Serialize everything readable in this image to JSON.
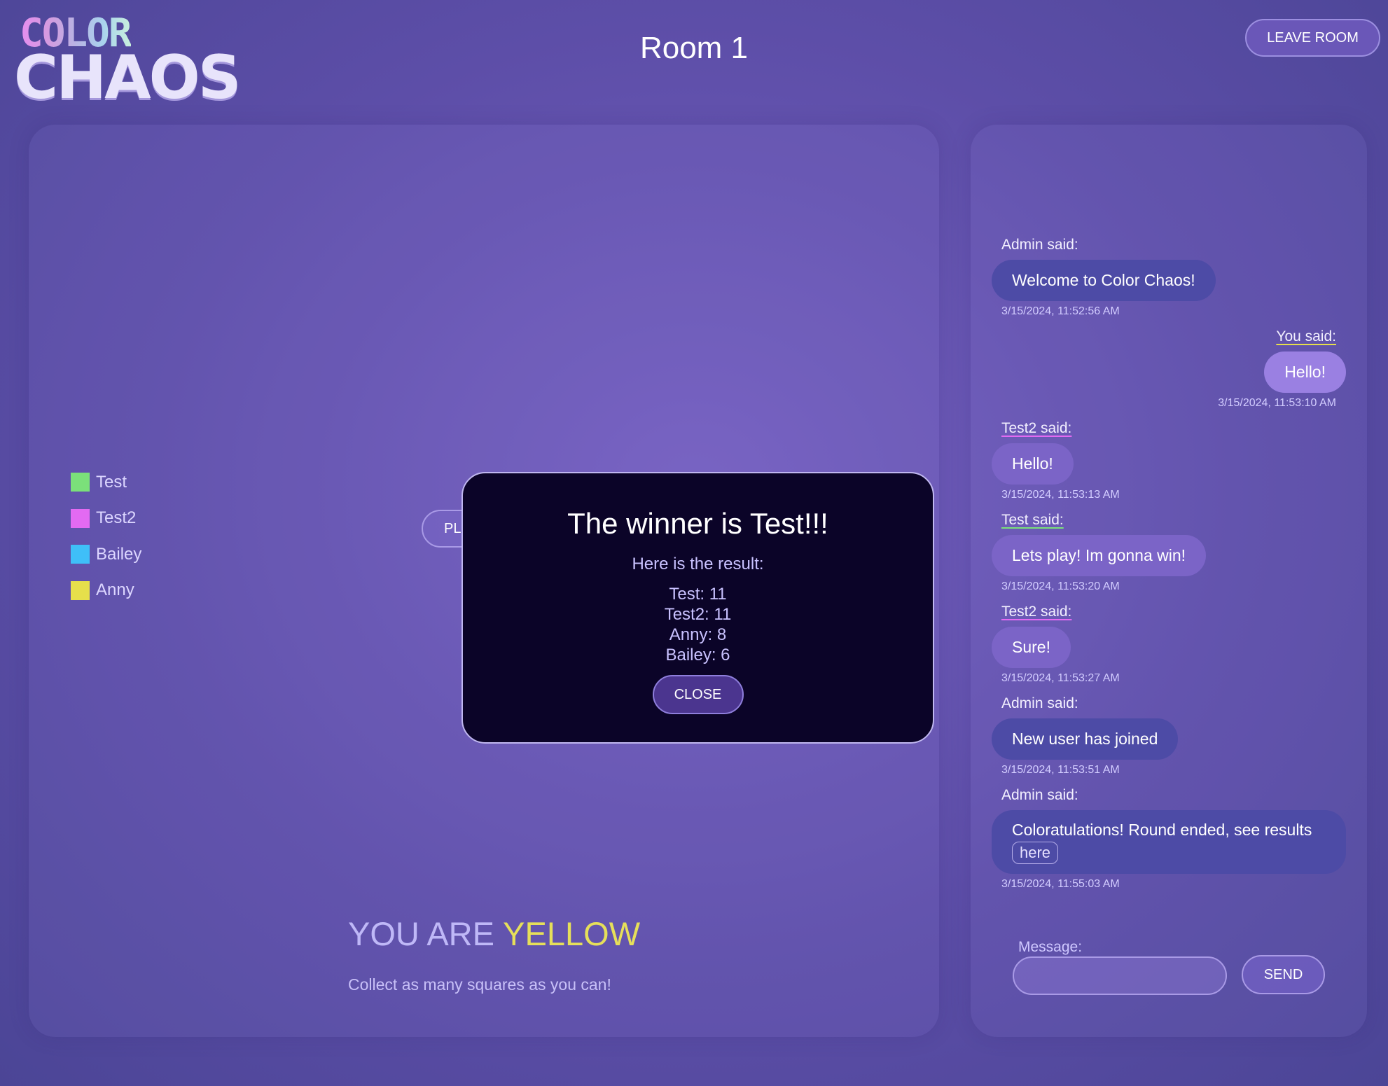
{
  "logo": {
    "top": "COLOR",
    "bottom": "CHAOS"
  },
  "header": {
    "room_title": "Room 1",
    "leave_label": "LEAVE ROOM"
  },
  "players": [
    {
      "name": "Test",
      "color": "#7be07a"
    },
    {
      "name": "Test2",
      "color": "#e36af2"
    },
    {
      "name": "Bailey",
      "color": "#3fbff8"
    },
    {
      "name": "Anny",
      "color": "#e6df4b"
    }
  ],
  "game": {
    "play_label": "PL",
    "you_are_prefix": "YOU ARE",
    "you_are_color": "YELLOW",
    "instruction": "Collect as many squares as you can!"
  },
  "modal": {
    "title": "The winner is Test!!!",
    "subtitle": "Here is the result:",
    "results": [
      "Test: 11",
      "Test2: 11",
      "Anny: 8",
      "Bailey: 6"
    ],
    "close_label": "CLOSE"
  },
  "chat": {
    "messages": [
      {
        "author": "Admin said:",
        "text": "Welcome to Color Chaos!",
        "time": "3/15/2024, 11:52:56 AM"
      },
      {
        "author": "You said:",
        "text": "Hello!",
        "time": "3/15/2024, 11:53:10 AM"
      },
      {
        "author": "Test2 said:",
        "text": "Hello!",
        "time": "3/15/2024, 11:53:13 AM"
      },
      {
        "author": "Test said:",
        "text": "Lets play! Im gonna win!",
        "time": "3/15/2024, 11:53:20 AM"
      },
      {
        "author": "Test2 said:",
        "text": "Sure!",
        "time": "3/15/2024, 11:53:27 AM"
      },
      {
        "author": "Admin said:",
        "text": "New user has joined",
        "time": "3/15/2024, 11:53:51 AM"
      },
      {
        "author": "Admin said:",
        "text": "Coloratulations! Round ended, see results",
        "link": "here",
        "time": "3/15/2024, 11:55:03 AM"
      }
    ],
    "underline_colors": {
      "you": "#e6df4b",
      "test2": "#e36af2",
      "test": "#7be07a"
    },
    "message_label": "Message:",
    "message_value": "",
    "send_label": "SEND"
  }
}
